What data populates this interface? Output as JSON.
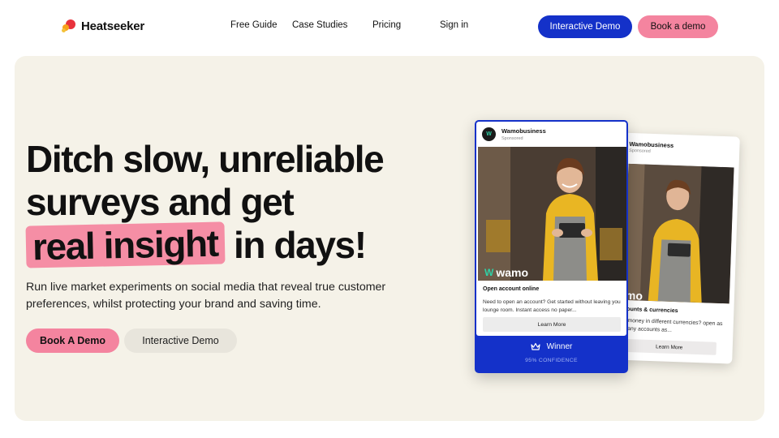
{
  "brand": {
    "name": "Heatseeker"
  },
  "nav": {
    "links": [
      "Free Guide",
      "Case Studies",
      "Pricing",
      "Sign in"
    ],
    "primary_cta": "Interactive Demo",
    "secondary_cta": "Book a demo"
  },
  "hero": {
    "headline_line1": "Ditch slow, unreliable",
    "headline_line2": "surveys and get",
    "headline_highlight": "real insight",
    "headline_line3_rest": "in days!",
    "subtext": "Run live market experiments on social media that reveal true customer preferences, whilst protecting your brand and saving time.",
    "cta_book": "Book A Demo",
    "cta_demo": "Interactive Demo"
  },
  "ad_front": {
    "account": "Wamobusiness",
    "sponsored": "Sponsored",
    "brand_overlay": "wamo",
    "title": "Open account online",
    "body": "Need to open an account? Get started without leaving you lounge room. Instant access no paper...",
    "button": "Learn More",
    "result_label": "Winner",
    "confidence": "95% CONFIDENCE"
  },
  "ad_back": {
    "account": "Wamobusiness",
    "sponsored": "Sponsored",
    "brand_overlay": "mo",
    "title": "counts & currencies",
    "body": "d money in different currencies? open as many accounts as...",
    "button": "Learn More"
  },
  "colors": {
    "accent_blue": "#1431c9",
    "accent_pink": "#f4849f",
    "hero_bg": "#f5f2e8",
    "wamo_green": "#2fd1a6"
  }
}
